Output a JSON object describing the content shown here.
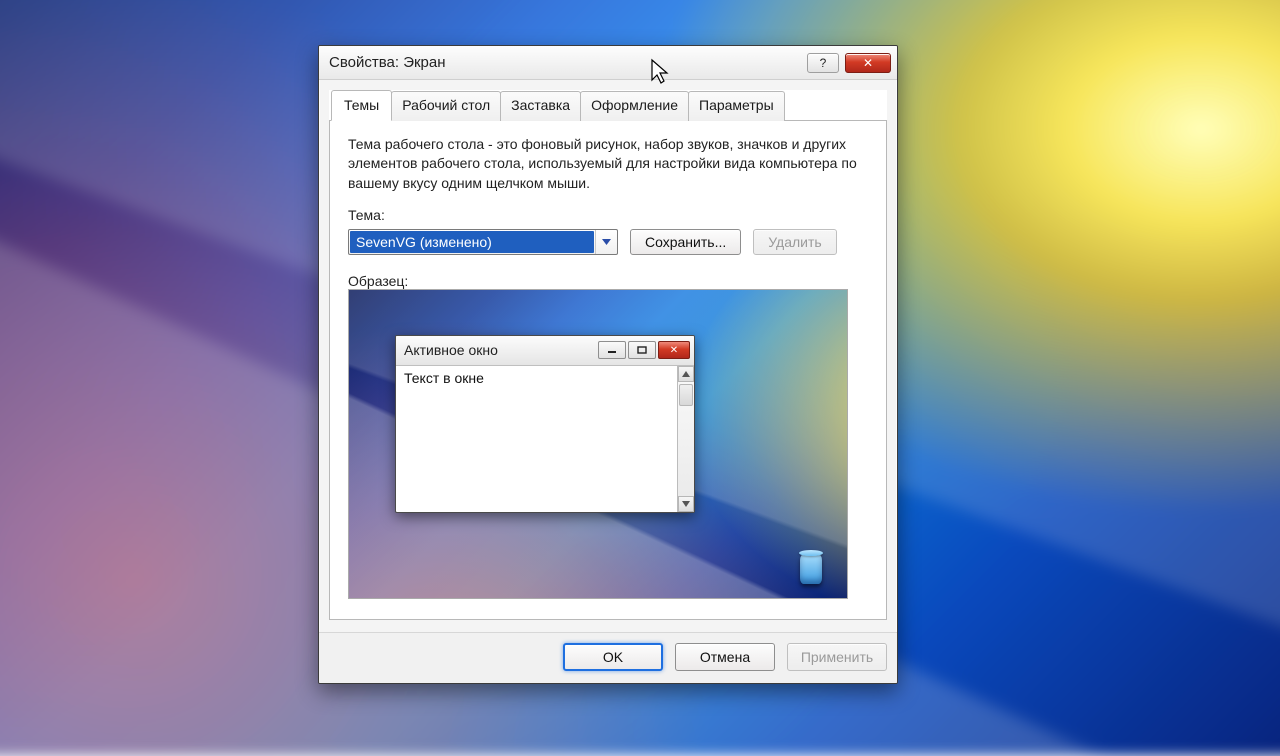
{
  "window": {
    "title": "Свойства: Экран",
    "help_label": "?",
    "close_label": "✕"
  },
  "tabs": [
    "Темы",
    "Рабочий стол",
    "Заставка",
    "Оформление",
    "Параметры"
  ],
  "active_tab": 0,
  "panel": {
    "description": "Тема рабочего стола - это фоновый рисунок, набор звуков, значков и других элементов рабочего стола, используемый для настройки вида компьютера по вашему вкусу одним щелчком мыши.",
    "theme_label": "Тема:",
    "theme_value": "SevenVG (изменено)",
    "save_label": "Сохранить...",
    "delete_label": "Удалить",
    "sample_label": "Образец:"
  },
  "sample_window": {
    "title": "Активное окно",
    "body_text": "Текст в окне"
  },
  "buttons": {
    "ok": "OK",
    "cancel": "Отмена",
    "apply": "Применить"
  }
}
